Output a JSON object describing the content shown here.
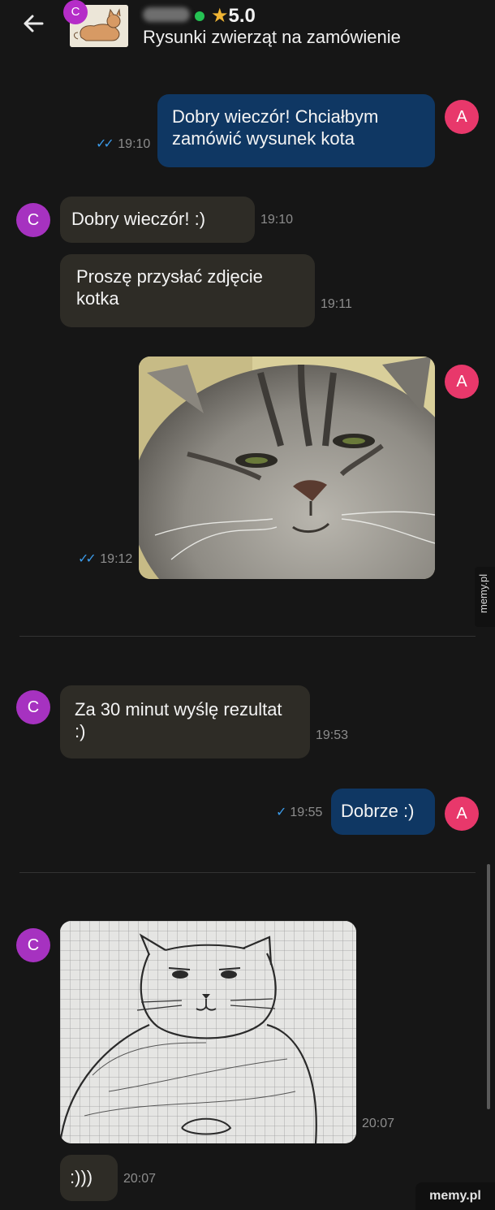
{
  "header": {
    "back_icon": "arrow-left-icon",
    "thumb_badge": "C",
    "rating": "5.0",
    "rating_icon": "star-icon",
    "title": "Rysunki zwierząt na zamówienie",
    "online_color": "#25c253"
  },
  "avatars": {
    "me": "A",
    "seller": "C"
  },
  "messages": [
    {
      "from": "me",
      "text": "Dobry wieczór! Chciałbym zamówić wysunek kota",
      "time": "19:10",
      "status": "read"
    },
    {
      "from": "seller",
      "text": "Dobry wieczór! :)",
      "time": "19:10"
    },
    {
      "from": "seller",
      "text": "Proszę przysłać zdjęcie kotka",
      "time": "19:11"
    },
    {
      "from": "me",
      "type": "photo",
      "content": "cat-photo",
      "time": "19:12",
      "status": "read"
    },
    {
      "from": "seller",
      "text": "Za 30 minut wyślę rezultat :)",
      "time": "19:53"
    },
    {
      "from": "me",
      "text": "Dobrze :)",
      "time": "19:55",
      "status": "sent"
    },
    {
      "from": "seller",
      "type": "photo",
      "content": "cat-drawing",
      "time": "20:07"
    },
    {
      "from": "seller",
      "text": ":)))",
      "time": "20:07"
    }
  ],
  "watermark": {
    "side": "memy.pl",
    "bottom": "memy.pl"
  },
  "colors": {
    "outgoing": "#0f3763",
    "incoming": "#2e2c26",
    "avatar_me": "#e8386b",
    "avatar_seller": "#a632c0",
    "read_ticks": "#3b9ae8"
  }
}
